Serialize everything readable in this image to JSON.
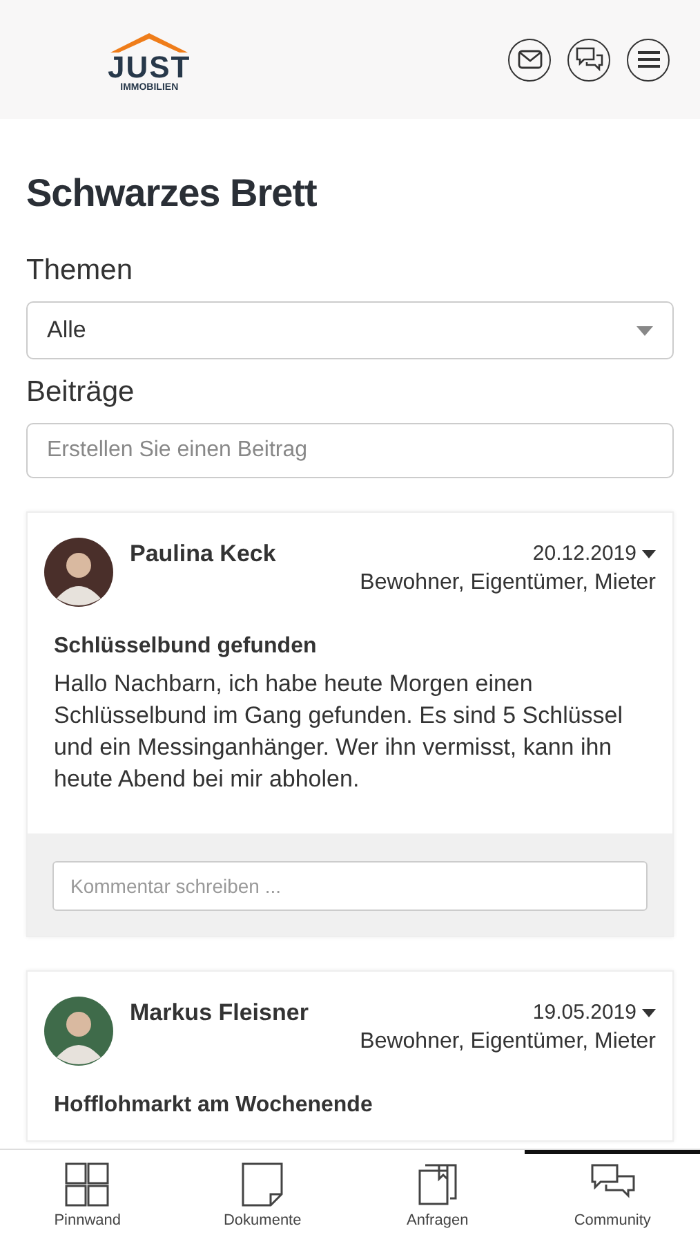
{
  "header": {
    "logo": {
      "name": "JUST",
      "sub": "IMMOBILIEN"
    }
  },
  "page_title": "Schwarzes Brett",
  "topics": {
    "label": "Themen",
    "value": "Alle"
  },
  "posts_section": {
    "label": "Beiträge",
    "placeholder": "Erstellen Sie einen Beitrag"
  },
  "posts": [
    {
      "author": "Paulina Keck",
      "date": "20.12.2019",
      "audience": "Bewohner, Eigentümer, Mieter",
      "title": "Schlüsselbund gefunden",
      "body": "Hallo Nachbarn, ich habe heute Morgen einen Schlüsselbund im Gang gefunden. Es sind 5 Schlüssel und ein Messinganhänger. Wer ihn vermisst, kann ihn heute Abend bei mir abholen.",
      "comment_placeholder": "Kommentar schreiben ..."
    },
    {
      "author": "Markus Fleisner",
      "date": "19.05.2019",
      "audience": "Bewohner, Eigentümer, Mieter",
      "title": "Hofflohmarkt am Wochenende"
    }
  ],
  "nav": [
    {
      "label": "Pinnwand",
      "kind": "grid",
      "selected": false
    },
    {
      "label": "Dokumente",
      "kind": "note",
      "selected": false
    },
    {
      "label": "Anfragen",
      "kind": "folder",
      "selected": false
    },
    {
      "label": "Community",
      "kind": "chat",
      "selected": true
    }
  ]
}
